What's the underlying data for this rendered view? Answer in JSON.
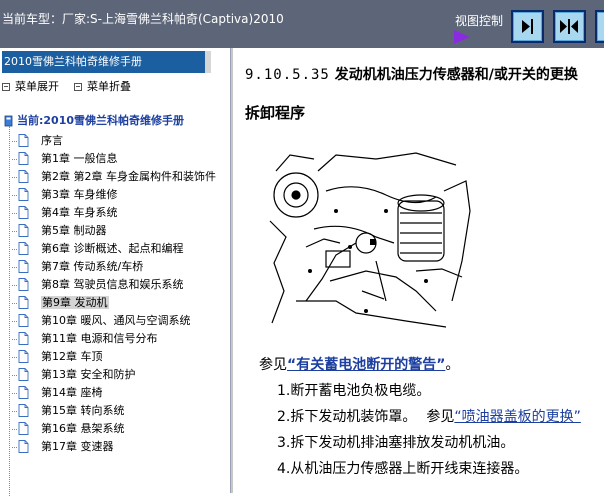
{
  "topbar": {
    "vehicle_label": "当前车型：厂家:S-上海雪佛兰科帕奇(Captiva)2010",
    "view_control_label": "视图控制"
  },
  "left_panel": {
    "header": "2010雪佛兰科帕奇维修手册",
    "expand_all": "菜单展开",
    "collapse_all": "菜单折叠",
    "current_manual": "当前:2010雪佛兰科帕奇维修手册",
    "chapters": [
      "序言",
      "第1章 一般信息",
      "第2章 第2章 车身金属构件和装饰件",
      "第3章 车身维修",
      "第4章 车身系统",
      "第5章 制动器",
      "第6章 诊断概述、起点和编程",
      "第7章 传动系统/车桥",
      "第8章 驾驶员信息和娱乐系统",
      "第9章 发动机",
      "第10章 暖风、通风与空调系统",
      "第11章 电源和信号分布",
      "第12章 车顶",
      "第13章 安全和防护",
      "第14章 座椅",
      "第15章 转向系统",
      "第16章 悬架系统",
      "第17章 变速器"
    ],
    "selected_index": 9
  },
  "content": {
    "section_number": "9.10.5.35",
    "section_title": "发动机机油压力传感器和/或开关的更换",
    "procedure_heading": "拆卸程序",
    "warning_prefix": "参见",
    "warning_link": "“有关蓄电池断开的警告”",
    "warning_suffix": "。",
    "steps": [
      {
        "text": "1.断开蓄电池负极电缆。"
      },
      {
        "text": "2.拆下发动机装饰罩。",
        "ref_prefix": "参见",
        "ref_link": "“喷油器盖板的更换”"
      },
      {
        "text": "3.拆下发动机排油塞排放发动机机油。"
      },
      {
        "text": "4.从机油压力传感器上断开线束连接器。"
      }
    ]
  },
  "colors": {
    "topbar_bg": "#5d6678",
    "header_bg": "#1c5fa0",
    "link": "#1c3fa0",
    "arrow": "#8a2be2"
  }
}
